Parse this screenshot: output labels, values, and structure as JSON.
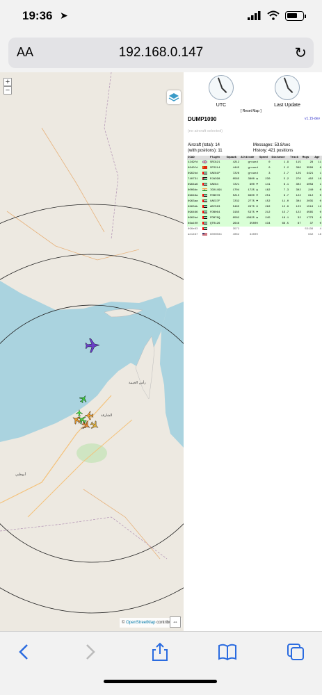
{
  "status_bar": {
    "time": "19:36",
    "location_icon": "location-arrow-icon",
    "signal_icon": "signal-bars-icon",
    "wifi_icon": "wifi-icon",
    "battery_icon": "battery-icon"
  },
  "browser": {
    "text_size_label": "AA",
    "url": "192.168.0.147",
    "reload_icon": "reload-icon"
  },
  "map": {
    "zoom_in": "+",
    "zoom_out": "−",
    "attribution_prefix": "©",
    "attribution_link": "OpenStreetMap",
    "attribution_suffix": " contributors.",
    "water_color": "#aad3df",
    "land_color": "#ede9e1",
    "place_labels": [
      "دبي",
      "أبوظبي",
      "رأس الخيمة",
      "الشارقة"
    ]
  },
  "panel": {
    "clock_utc_label": "UTC",
    "clock_last_update_label": "Last Update",
    "reset_map": "[ Reset Map ]",
    "title": "DUMP1090",
    "version": "v1.15-dev",
    "no_aircraft": "(no aircraft selected)",
    "aircraft_total": "Aircraft (total): 14",
    "with_positions": "(with positions): 11",
    "messages": "Messages: 53.8/sec",
    "history": "History: 421 positions"
  },
  "table": {
    "headers": [
      "ICAO",
      "",
      "Flight",
      "Squawk",
      "Altitude",
      "Speed",
      "Distance",
      "Track",
      "Msgs",
      "Age"
    ],
    "rows": [
      {
        "icao": "4249fd",
        "flag": "gb",
        "flight": "SRC821",
        "squawk": "4212",
        "altitude": "ground",
        "speed": "0",
        "distance": "1.9",
        "track": "115",
        "msgs": "28",
        "age": "11",
        "pos": true
      },
      {
        "icao": "8940fd",
        "flag": "cn",
        "flight": "SFS214",
        "squawk": "4445",
        "altitude": "ground",
        "speed": "0",
        "distance": "2.2",
        "track": "300",
        "msgs": "3590",
        "age": "0",
        "pos": true
      },
      {
        "icao": "8962bd",
        "flag": "ae",
        "flight": "UAE81P",
        "squawk": "7226",
        "altitude": "ground",
        "speed": "3",
        "distance": "2.7",
        "track": "129",
        "msgs": "4421",
        "age": "1",
        "pos": true
      },
      {
        "icao": "740731",
        "flag": "jo",
        "flight": "RJA398",
        "squawk": "0565",
        "altitude": "3800 ▲",
        "speed": "230",
        "distance": "5.2",
        "track": "270",
        "msgs": "402",
        "age": "10",
        "pos": true
      },
      {
        "icao": "8964a6",
        "flag": "ae",
        "flight": "UAE64",
        "squawk": "7221",
        "altitude": "900 ▼",
        "speed": "141",
        "distance": "6.1",
        "track": "302",
        "msgs": "4058",
        "age": "1",
        "pos": true
      },
      {
        "icao": "8006dc",
        "flag": "in",
        "flight": "IGO1494",
        "squawk": "1704",
        "altitude": "1725 ▲",
        "speed": "162",
        "distance": "7.3",
        "track": "302",
        "msgs": "240",
        "age": "0",
        "pos": true
      },
      {
        "icao": "89648a",
        "flag": "ae",
        "flight": "FDB076",
        "squawk": "5215",
        "altitude": "6600 ▼",
        "speed": "251",
        "distance": "9.7",
        "track": "122",
        "msgs": "612",
        "age": "0",
        "pos": true
      },
      {
        "icao": "8963aa",
        "flag": "ae",
        "flight": "UAE37F",
        "squawk": "7232",
        "altitude": "2775 ▼",
        "speed": "152",
        "distance": "11.0",
        "track": "304",
        "msgs": "2035",
        "age": "0",
        "pos": true
      },
      {
        "icao": "8963db",
        "flag": "ae",
        "flight": "ABY563",
        "squawk": "5465",
        "altitude": "2675 ▼",
        "speed": "262",
        "distance": "12.9",
        "track": "123",
        "msgs": "1516",
        "age": "12",
        "pos": true
      },
      {
        "icao": "896466",
        "flag": "ae",
        "flight": "FDB064",
        "squawk": "3185",
        "altitude": "5375 ▼",
        "speed": "212",
        "distance": "15.7",
        "track": "122",
        "msgs": "4565",
        "age": "0",
        "pos": true
      },
      {
        "icao": "8962bd",
        "flag": "ae",
        "flight": "FDB76Q",
        "squawk": "0582",
        "altitude": "10625 ▲",
        "speed": "245",
        "distance": "18.1",
        "track": "32",
        "msgs": "1773",
        "age": "0",
        "pos": true
      },
      {
        "icao": "86a100",
        "flag": "ae",
        "flight": "QTR126",
        "squawk": "2646",
        "altitude": "35000",
        "speed": "434",
        "distance": "66.5",
        "track": "87",
        "msgs": "37",
        "age": "0",
        "pos": true
      },
      {
        "icao": "896e83",
        "flag": "ae",
        "flight": "",
        "squawk": "3572",
        "altitude": "",
        "speed": "",
        "distance": "",
        "track": "",
        "msgs": "55136",
        "age": "4",
        "pos": false
      },
      {
        "icao": "ae1467",
        "flag": "us",
        "flight": "9000E84",
        "squawk": "4062",
        "altitude": "34000",
        "speed": "",
        "distance": "",
        "track": "",
        "msgs": "632",
        "age": "18",
        "pos": false
      }
    ]
  },
  "toolbar": {
    "back_icon": "back-icon",
    "forward_icon": "forward-icon",
    "share_icon": "share-icon",
    "bookmarks_icon": "bookmarks-icon",
    "tabs_icon": "tabs-icon"
  }
}
